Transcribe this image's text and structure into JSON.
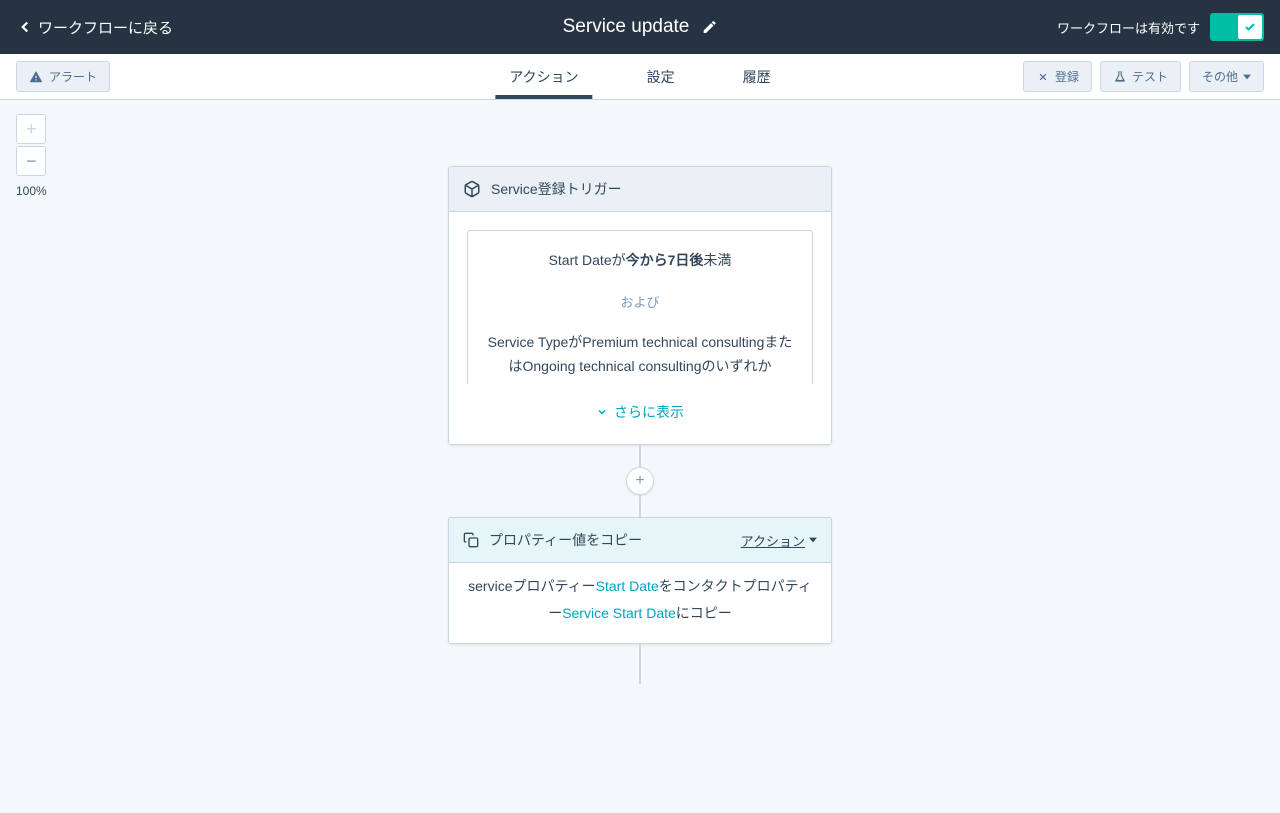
{
  "header": {
    "back_label": "ワークフローに戻る",
    "title": "Service update",
    "enabled_text": "ワークフローは有効です"
  },
  "subheader": {
    "alert_label": "アラート",
    "tabs": {
      "action": "アクション",
      "settings": "設定",
      "history": "履歴"
    },
    "register_label": "登録",
    "test_label": "テスト",
    "more_label": "その他"
  },
  "zoom": {
    "level": "100%"
  },
  "trigger": {
    "title": "Service登録トリガー",
    "cond1_prefix": "Start Dateが",
    "cond1_bold": "今から7日後",
    "cond1_suffix": "未満",
    "and_label": "および",
    "cond2": "Service TypeがPremium technical consultingまたはOngoing technical consultingのいずれか",
    "show_more": "さらに表示"
  },
  "action_card": {
    "title": "プロパティー値をコピー",
    "action_label": "アクション",
    "body_p1": "serviceプロパティー",
    "body_link1": "Start Date",
    "body_p2": "をコンタクトプロパティー",
    "body_link2": "Service Start Date",
    "body_p3": "にコピー"
  }
}
